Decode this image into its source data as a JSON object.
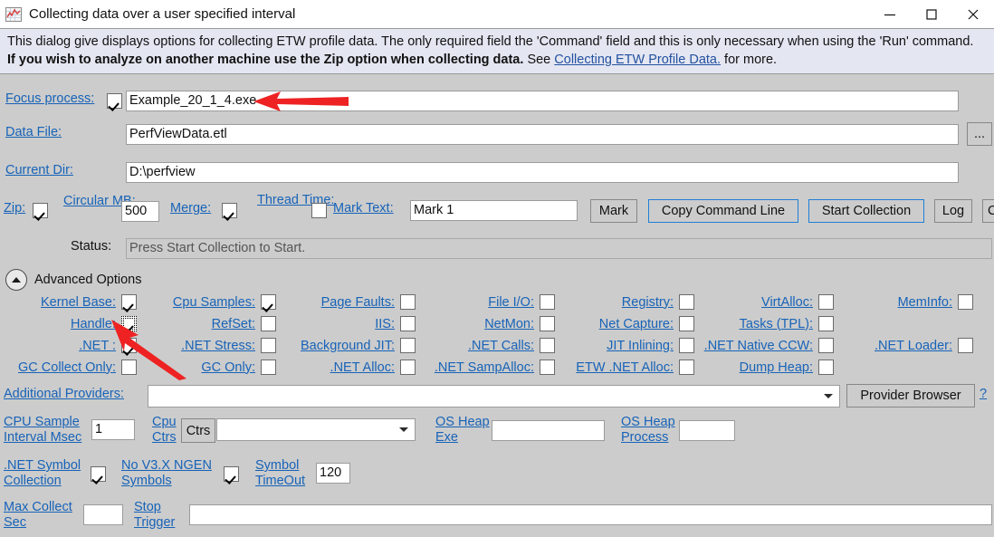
{
  "window": {
    "title": "Collecting data over a user specified interval",
    "icon": "chart-icon",
    "minimize": "—",
    "maximize": "□",
    "close": "✕"
  },
  "banner": {
    "line1": "This dialog give displays options for collecting ETW profile data. The only required field the 'Command' field and this is only necessary when using the 'Run' command.",
    "line2_bold": "If you wish to analyze on another machine use the Zip option when collecting data.",
    "line2_see": "See",
    "line2_link": "Collecting ETW Profile Data.",
    "line2_tail": "for more."
  },
  "fields": {
    "focus_process_label": "Focus process:",
    "focus_process_checked": true,
    "focus_process_value": "Example_20_1_4.exe",
    "data_file_label": "Data File:",
    "data_file_value": "PerfViewData.etl",
    "browse_label": "...",
    "current_dir_label": "Current Dir:",
    "current_dir_value": "D:\\perfview"
  },
  "options_row": {
    "zip_label": "Zip:",
    "zip_checked": true,
    "circular_mb_label": "Circular MB:",
    "circular_mb_value": "500",
    "merge_label": "Merge:",
    "merge_checked": true,
    "thread_time_label": "Thread Time:",
    "thread_time_checked": false,
    "mark_text_label": "Mark Text:",
    "mark_text_value": "Mark 1",
    "mark_button": "Mark",
    "copy_command_line_button": "Copy Command Line",
    "start_collection_button": "Start Collection",
    "log_button": "Log",
    "clipped_button": "C"
  },
  "status": {
    "label": "Status:",
    "value": "Press Start Collection to Start."
  },
  "advanced": {
    "title": "Advanced Options",
    "collapse_icon": "chevron-up-icon",
    "checkboxes": [
      {
        "label": "Kernel Base:",
        "checked": true,
        "col": 0,
        "row": 0
      },
      {
        "label": "Cpu Samples:",
        "checked": true,
        "col": 1,
        "row": 0
      },
      {
        "label": "Page Faults:",
        "checked": false,
        "col": 2,
        "row": 0
      },
      {
        "label": "File I/O:",
        "checked": false,
        "col": 3,
        "row": 0
      },
      {
        "label": "Registry:",
        "checked": false,
        "col": 4,
        "row": 0
      },
      {
        "label": "VirtAlloc:",
        "checked": false,
        "col": 5,
        "row": 0
      },
      {
        "label": "MemInfo:",
        "checked": false,
        "col": 6,
        "row": 0
      },
      {
        "label": "Handle:",
        "checked": true,
        "col": 0,
        "row": 1,
        "focused": true
      },
      {
        "label": "RefSet:",
        "checked": false,
        "col": 1,
        "row": 1
      },
      {
        "label": "IIS:",
        "checked": false,
        "col": 2,
        "row": 1
      },
      {
        "label": "NetMon:",
        "checked": false,
        "col": 3,
        "row": 1
      },
      {
        "label": "Net Capture:",
        "checked": false,
        "col": 4,
        "row": 1
      },
      {
        "label": "Tasks (TPL):",
        "checked": false,
        "col": 5,
        "row": 1
      },
      {
        "label": ".NET :",
        "checked": true,
        "col": 0,
        "row": 2
      },
      {
        "label": ".NET Stress:",
        "checked": false,
        "col": 1,
        "row": 2
      },
      {
        "label": "Background JIT:",
        "checked": false,
        "col": 2,
        "row": 2
      },
      {
        "label": ".NET Calls:",
        "checked": false,
        "col": 3,
        "row": 2
      },
      {
        "label": "JIT Inlining:",
        "checked": false,
        "col": 4,
        "row": 2
      },
      {
        "label": ".NET Native CCW:",
        "checked": false,
        "col": 5,
        "row": 2
      },
      {
        "label": ".NET Loader:",
        "checked": false,
        "col": 6,
        "row": 2
      },
      {
        "label": "GC Collect Only:",
        "checked": false,
        "col": 0,
        "row": 3
      },
      {
        "label": "GC Only:",
        "checked": false,
        "col": 1,
        "row": 3
      },
      {
        "label": ".NET Alloc:",
        "checked": false,
        "col": 2,
        "row": 3
      },
      {
        "label": ".NET SampAlloc:",
        "checked": false,
        "col": 3,
        "row": 3
      },
      {
        "label": "ETW .NET Alloc:",
        "checked": false,
        "col": 4,
        "row": 3
      },
      {
        "label": "Dump Heap:",
        "checked": false,
        "col": 5,
        "row": 3
      }
    ],
    "additional_providers_label": "Additional Providers:",
    "additional_providers_value": "",
    "provider_browser_button": "Provider Browser",
    "help_button": "?",
    "cpu_sample_interval_label": "CPU Sample Interval Msec",
    "cpu_sample_interval_value": "1",
    "cpu_ctrs_label": "Cpu Ctrs",
    "ctrs_button": "Ctrs",
    "cpu_ctrs_value": "",
    "os_heap_exe_label": "OS Heap Exe",
    "os_heap_exe_value": "",
    "os_heap_process_label": "OS Heap Process",
    "os_heap_process_value": "",
    "net_symbol_collection_label": ".NET Symbol Collection",
    "net_symbol_collection_checked": true,
    "no_ngen_label": "No V3.X NGEN Symbols",
    "no_ngen_checked": true,
    "symbol_timeout_label": "Symbol TimeOut",
    "symbol_timeout_value": "120",
    "max_collect_sec_label": "Max Collect Sec",
    "max_collect_sec_value": "",
    "stop_trigger_label": "Stop Trigger",
    "stop_trigger_value": ""
  },
  "colors": {
    "link": "#1763b8",
    "banner_bg": "#e4e6f2",
    "body_bg": "#cccccc",
    "accent_border": "#1f7fd6",
    "arrow": "#ee2222"
  }
}
